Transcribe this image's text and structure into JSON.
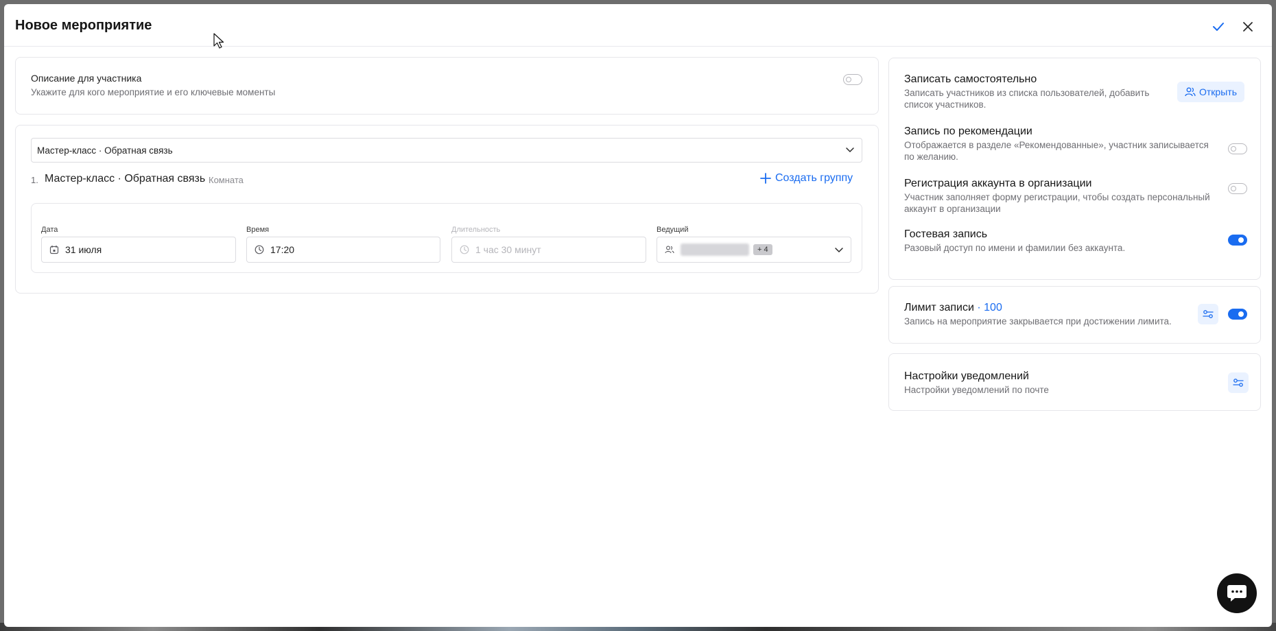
{
  "modal": {
    "title": "Новое мероприятие"
  },
  "description": {
    "title": "Описание для участника",
    "subtitle": "Укажите для кого мероприятие и его ключевые моменты",
    "enabled": false
  },
  "session": {
    "selected": "Мастер-класс · Обратная связь",
    "item_number": "1.",
    "item_title": "Мастер-класс · Обратная связь",
    "item_location": "Комната",
    "create_group_label": "Создать группу",
    "date_label": "Дата",
    "date_value": "31 июля",
    "time_label": "Время",
    "time_value": "17:20",
    "duration_label": "Длительность",
    "duration_value": "1 час 30 минут",
    "host_label": "Ведущий",
    "host_more_badge": "+ 4"
  },
  "enrollment": {
    "self_title": "Записать самостоятельно",
    "self_subtitle": "Записать участников из списка пользователей, добавить список участников.",
    "open_button": "Открыть",
    "recommend_title": "Запись по рекомендации",
    "recommend_subtitle": "Отображается в разделе «Рекомендованные», участник записывается по желанию.",
    "recommend_enabled": false,
    "org_title": "Регистрация аккаунта в организации",
    "org_subtitle": "Участник заполняет форму регистрации, чтобы создать персональный аккаунт в организации",
    "org_enabled": false,
    "guest_title": "Гостевая запись",
    "guest_subtitle": "Разовый доступ по имени и фамилии без аккаунта.",
    "guest_enabled": true
  },
  "limit": {
    "title": "Лимит записи",
    "separator": " · ",
    "value": "100",
    "subtitle": "Запись на мероприятие закрывается при достижении лимита.",
    "enabled": true
  },
  "notifications": {
    "title": "Настройки уведомлений",
    "subtitle": "Настройки уведомлений по почте"
  },
  "colors": {
    "accent": "#1a6cf0",
    "accent_soft": "#eaf2ff",
    "border": "#e6e6ea"
  }
}
